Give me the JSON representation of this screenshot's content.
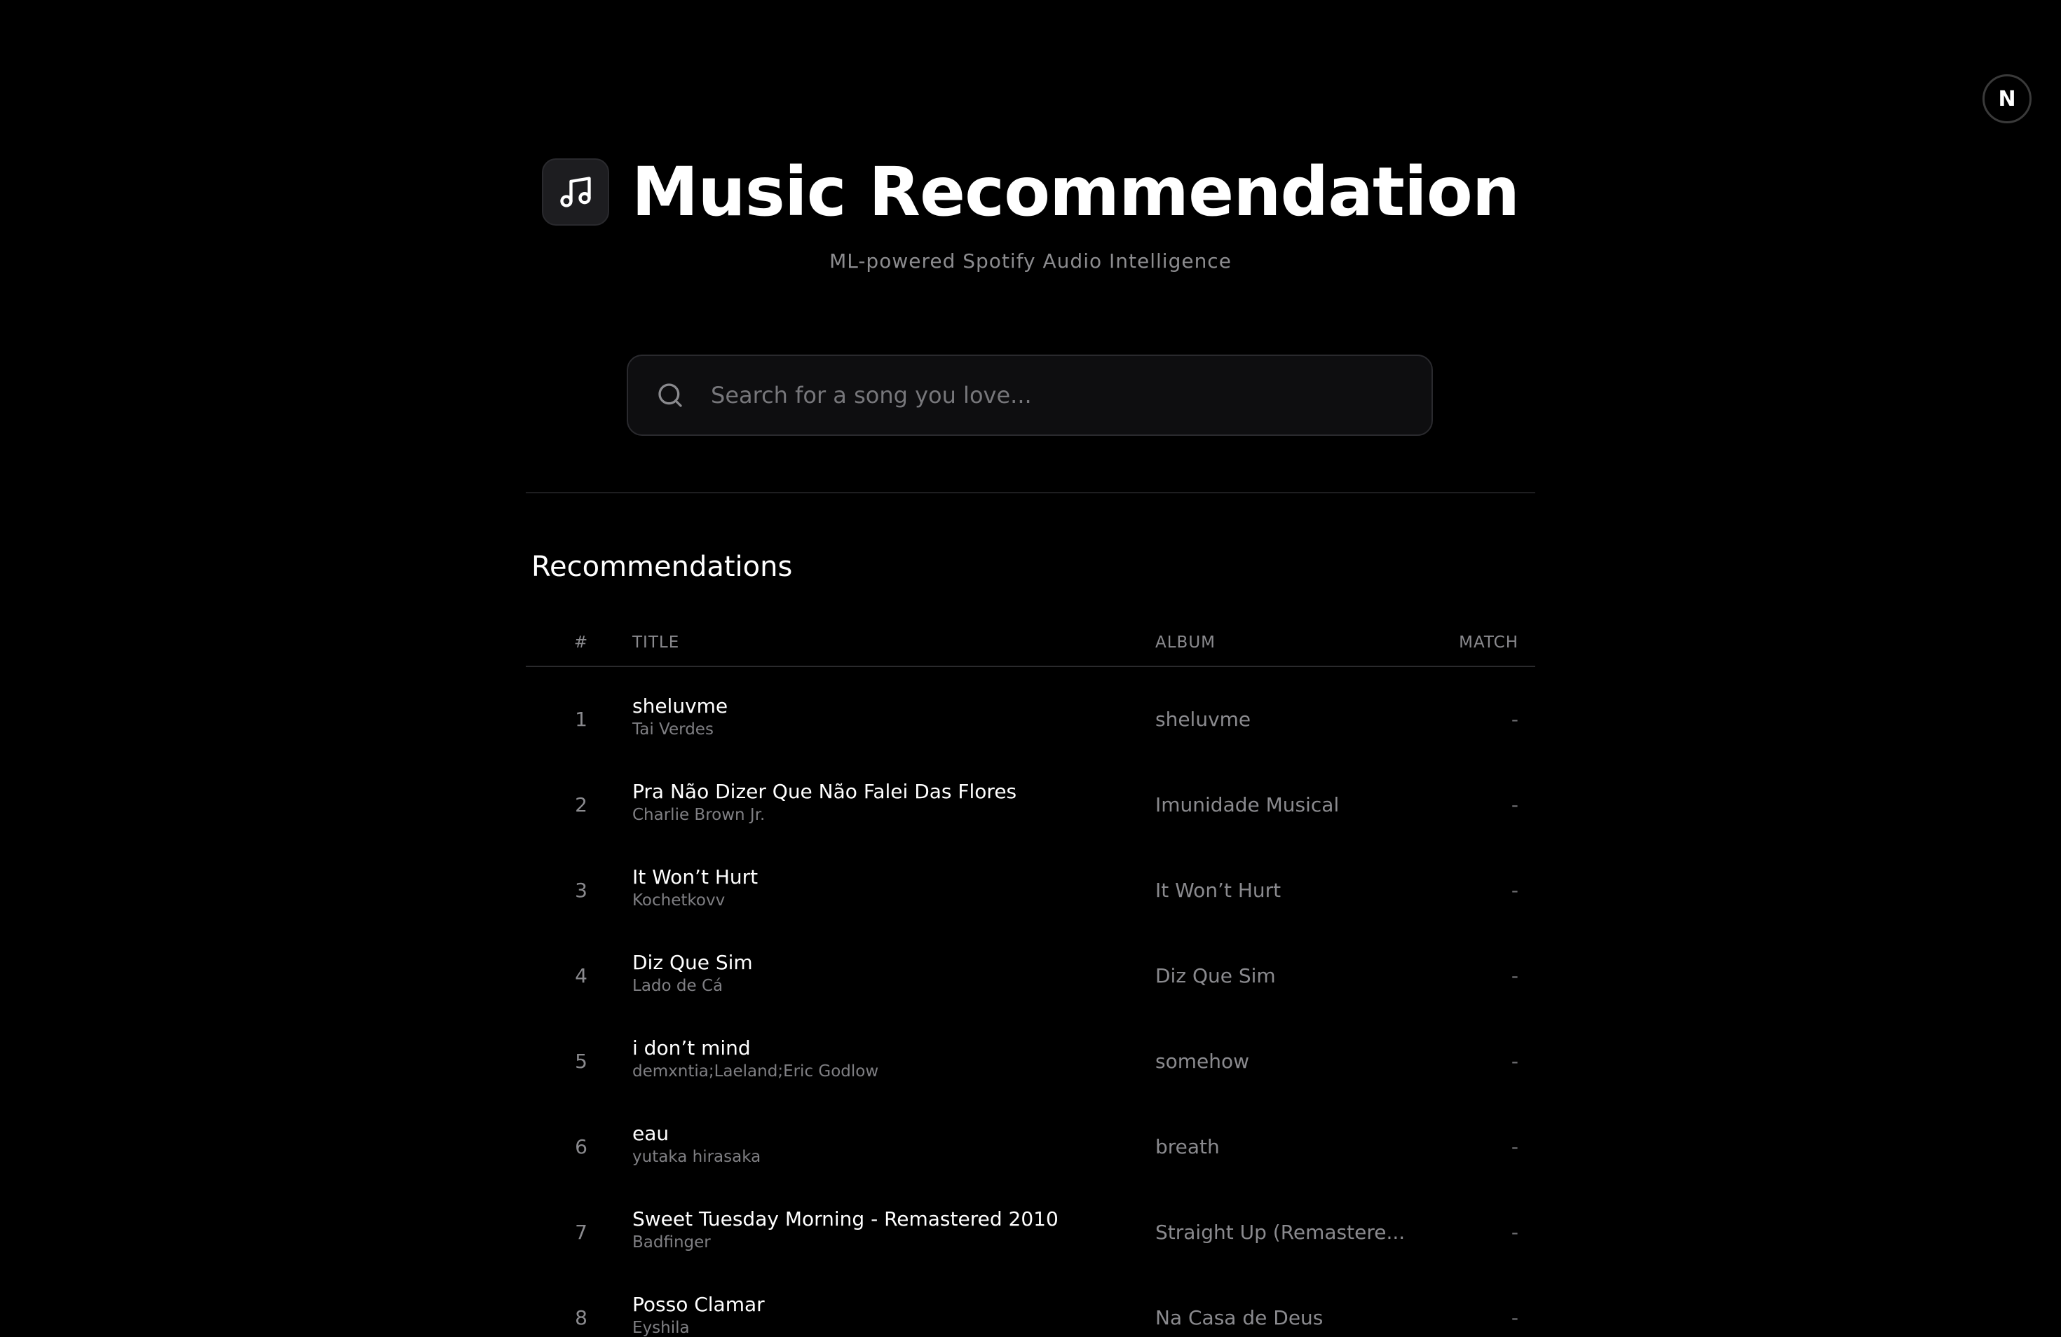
{
  "nav_badge": {
    "label": "N"
  },
  "header": {
    "icon": "music-note-icon",
    "title": "Music Recommendation",
    "subtitle": "ML-powered Spotify Audio Intelligence"
  },
  "search": {
    "icon": "search-icon",
    "placeholder": "Search for a song you love...",
    "value": ""
  },
  "recommendations": {
    "heading": "Recommendations",
    "columns": {
      "num": "#",
      "title": "TITLE",
      "album": "ALBUM",
      "match": "MATCH"
    },
    "rows": [
      {
        "num": "1",
        "title": "sheluvme",
        "artist": "Tai Verdes",
        "album": "sheluvme",
        "match": "-"
      },
      {
        "num": "2",
        "title": "Pra Não Dizer Que Não Falei Das Flores",
        "artist": "Charlie Brown Jr.",
        "album": "Imunidade Musical",
        "match": "-"
      },
      {
        "num": "3",
        "title": "It Won’t Hurt",
        "artist": "Kochetkovv",
        "album": "It Won’t Hurt",
        "match": "-"
      },
      {
        "num": "4",
        "title": "Diz Que Sim",
        "artist": "Lado de Cá",
        "album": "Diz Que Sim",
        "match": "-"
      },
      {
        "num": "5",
        "title": "i don’t mind",
        "artist": "demxntia;Laeland;Eric Godlow",
        "album": "somehow",
        "match": "-"
      },
      {
        "num": "6",
        "title": "eau",
        "artist": "yutaka hirasaka",
        "album": "breath",
        "match": "-"
      },
      {
        "num": "7",
        "title": "Sweet Tuesday Morning - Remastered 2010",
        "artist": "Badfinger",
        "album": "Straight Up (Remastere...",
        "match": "-"
      },
      {
        "num": "8",
        "title": "Posso Clamar",
        "artist": "Eyshila",
        "album": "Na Casa de Deus",
        "match": "-"
      }
    ]
  },
  "colors": {
    "background": "#000000",
    "text_primary": "#ffffff",
    "text_secondary": "#8a8a8e",
    "panel": "#0e0e10",
    "border": "#2a2a2e"
  }
}
